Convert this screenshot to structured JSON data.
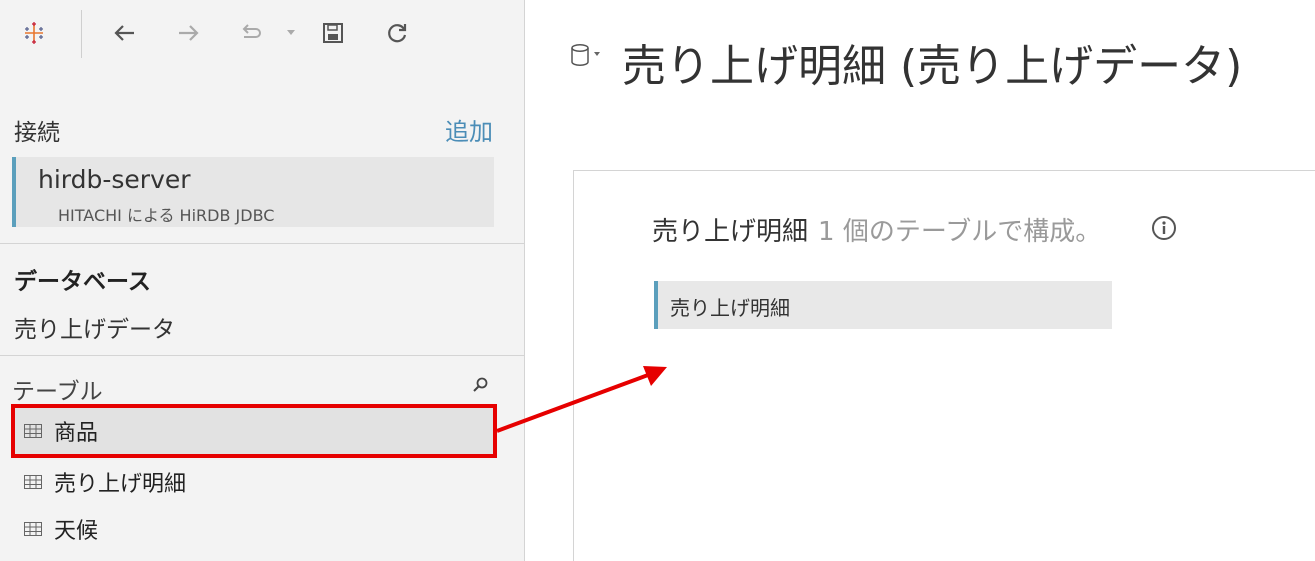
{
  "toolbar": {
    "logo_icon": "tableau-logo-icon",
    "back_icon": "arrow-left-icon",
    "forward_icon": "arrow-right-icon",
    "redo_icon": "redo-icon",
    "save_icon": "save-icon",
    "refresh_icon": "refresh-icon"
  },
  "connections": {
    "label": "接続",
    "add_label": "追加",
    "items": [
      {
        "name": "hirdb-server",
        "subtitle": "HITACHI による HiRDB JDBC"
      }
    ]
  },
  "database": {
    "heading": "データベース",
    "value": "売り上げデータ"
  },
  "tables": {
    "label": "テーブル",
    "items": [
      {
        "name": "商品",
        "selected": true
      },
      {
        "name": "売り上げ明細",
        "selected": false
      },
      {
        "name": "天候",
        "selected": false
      }
    ]
  },
  "main": {
    "title": "売り上げ明細 (売り上げデータ)",
    "caption_name": "売り上げ明細",
    "caption_desc": "1 個のテーブルで構成。",
    "logical_table": "売り上げ明細"
  },
  "colors": {
    "accent": "#5b9fbc",
    "link": "#4b8db7",
    "annotation": "#e60000"
  }
}
